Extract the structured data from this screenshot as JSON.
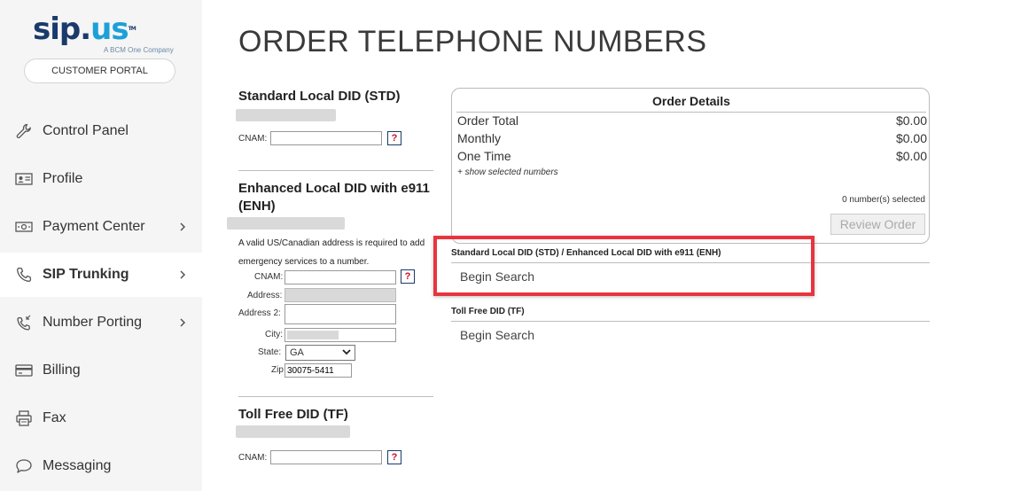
{
  "brand": {
    "logo_sip": "sip",
    "logo_dot": ".",
    "logo_us": "us",
    "logo_tm": "TM",
    "tagline": "A BCM One Company",
    "portal_label": "CUSTOMER PORTAL"
  },
  "nav": {
    "items": [
      {
        "label": "Control Panel",
        "icon": "wrench-icon"
      },
      {
        "label": "Profile",
        "icon": "id-card-icon"
      },
      {
        "label": "Payment Center",
        "icon": "payment-icon"
      },
      {
        "label": "SIP Trunking",
        "icon": "phone-icon",
        "active": true
      },
      {
        "label": "Number Porting",
        "icon": "phone-transfer-icon"
      },
      {
        "label": "Billing",
        "icon": "credit-card-icon"
      },
      {
        "label": "Fax",
        "icon": "printer-icon"
      },
      {
        "label": "Messaging",
        "icon": "chat-bubble-icon"
      }
    ]
  },
  "page": {
    "title": "ORDER TELEPHONE NUMBERS"
  },
  "std": {
    "title": "Standard Local DID (STD)",
    "cnam_label": "CNAM:",
    "cnam_value": "",
    "help": "?"
  },
  "enh": {
    "title_line1": "Enhanced Local DID with e911",
    "title_line2": "(ENH)",
    "note": "A valid US/Canadian address is required to add emergency services to a number.",
    "cnam_label": "CNAM:",
    "address_label": "Address:",
    "address2_label": "Address 2:",
    "city_label": "City:",
    "state_label": "State:",
    "state_value": "GA",
    "zip_label": "Zip",
    "zip_value": "30075-5411",
    "help": "?"
  },
  "tf": {
    "title": "Toll Free DID (TF)",
    "cnam_label": "CNAM:",
    "help": "?"
  },
  "order": {
    "heading": "Order Details",
    "rows": [
      {
        "label": "Order Total",
        "value": "$0.00"
      },
      {
        "label": "Monthly",
        "value": "$0.00"
      },
      {
        "label": "One Time",
        "value": "$0.00"
      }
    ],
    "show_selected": "+ show selected numbers",
    "selected_count": "0 number(s) selected",
    "review_label": "Review Order"
  },
  "search": {
    "local_title": "Standard Local DID (STD) / Enhanced Local DID with e911 (ENH)",
    "local_begin": "Begin Search",
    "tf_title": "Toll Free DID (TF)",
    "tf_begin": "Begin Search"
  },
  "colors": {
    "highlight": "#e8343e",
    "brand_navy": "#1a3a6b",
    "brand_blue": "#1ba0d8"
  }
}
